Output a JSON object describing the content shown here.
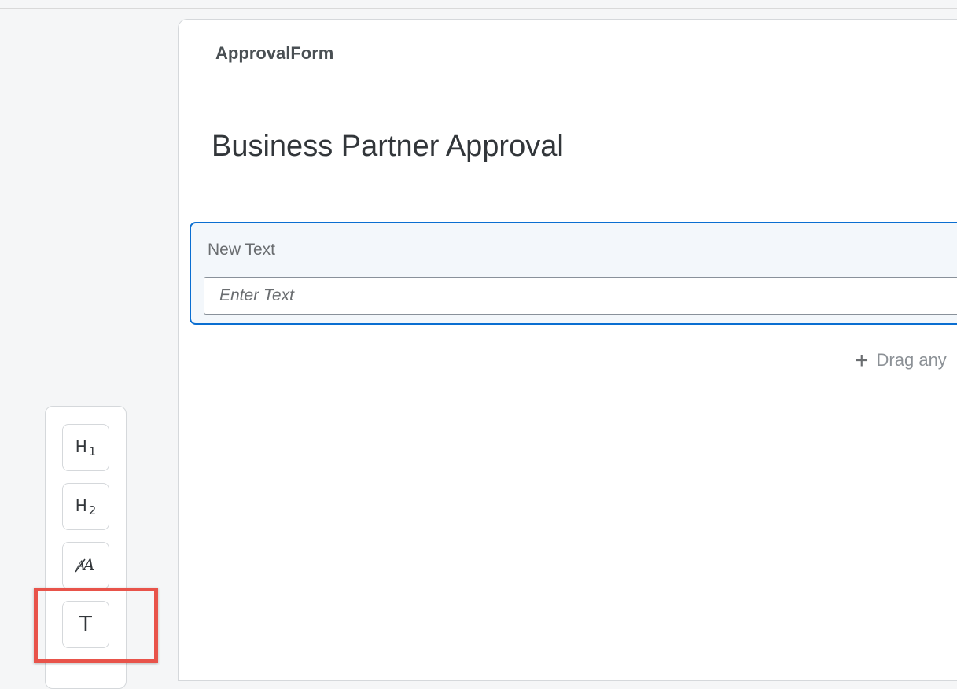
{
  "form_builder": {
    "form_name": "ApprovalForm",
    "form_title": "Business Partner Approval",
    "field": {
      "label": "New Text",
      "placeholder": "Enter Text"
    },
    "drag_hint": "Drag any"
  },
  "toolbar": {
    "items": [
      {
        "name": "heading-1",
        "label": "H",
        "sub": "1"
      },
      {
        "name": "heading-2",
        "label": "H",
        "sub": "2"
      },
      {
        "name": "text-style",
        "label": "AA"
      },
      {
        "name": "paragraph-text",
        "label": "T"
      }
    ]
  },
  "annotation": {
    "highlight_color": "#e8534a",
    "highlight_target": "paragraph-text"
  },
  "colors": {
    "accent": "#0a6ed1",
    "background": "#f5f6f7",
    "highlight": "#e8534a"
  }
}
